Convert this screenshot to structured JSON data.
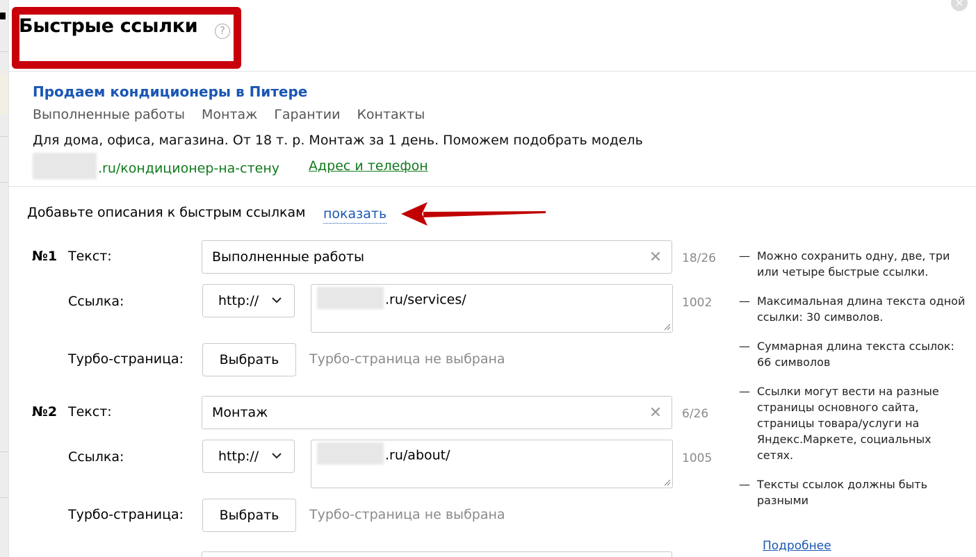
{
  "dialog": {
    "title": "Быстрые ссылки",
    "help_symbol": "?",
    "close_symbol": "×"
  },
  "preview": {
    "headline": "Продаем кондиционеры в Питере",
    "quicklinks": [
      "Выполненные работы",
      "Монтаж",
      "Гарантии",
      "Контакты"
    ],
    "description": "Для дома, офиса, магазина. От 18 т. р. Монтаж за 1 день. Поможем подобрать модель",
    "display_url": ".ru/кондиционер-на-стену",
    "contact_link": "Адрес и телефон"
  },
  "descriptions_prompt": {
    "text": "Добавьте описания к быстрым ссылкам",
    "show_link": "показать"
  },
  "links": [
    {
      "number": "№1",
      "text_label": "Текст:",
      "text_value": "Выполненные работы",
      "text_counter": "18/26",
      "url_label": "Ссылка:",
      "protocol": "http://",
      "url_value": ".ru/services/",
      "url_counter": "1002",
      "turbo_label": "Турбо-страница:",
      "turbo_button": "Выбрать",
      "turbo_status": "Турбо-страница не выбрана"
    },
    {
      "number": "№2",
      "text_label": "Текст:",
      "text_value": "Монтаж",
      "text_counter": "6/26",
      "url_label": "Ссылка:",
      "protocol": "http://",
      "url_value": ".ru/about/",
      "url_counter": "1005",
      "turbo_label": "Турбо-страница:",
      "turbo_button": "Выбрать",
      "turbo_status": "Турбо-страница не выбрана"
    }
  ],
  "tips": {
    "dash": "—",
    "items": [
      "Можно сохранить одну, две, три или четыре быстрые ссылки.",
      "Максимальная длина текста одной ссылки: 30 символов.",
      "Суммарная длина текста ссылок: 66 символов",
      "Ссылки могут вести на разные страницы основного сайта, страницы товара/услуги на Яндекс.Маркете, социальных сетях.",
      "Тексты ссылок должны быть разными"
    ],
    "more_link": "Подробнее"
  },
  "colors": {
    "highlight_frame": "#c8000b",
    "arrow": "#c00000",
    "link_blue": "#1a56b3",
    "url_green": "#107a1c"
  },
  "icons": {
    "help": "help-circle-icon",
    "close": "close-circle-icon",
    "clear": "clear-x-icon",
    "dropdown": "chevron-down-icon",
    "annotation": "red-arrow-icon"
  }
}
